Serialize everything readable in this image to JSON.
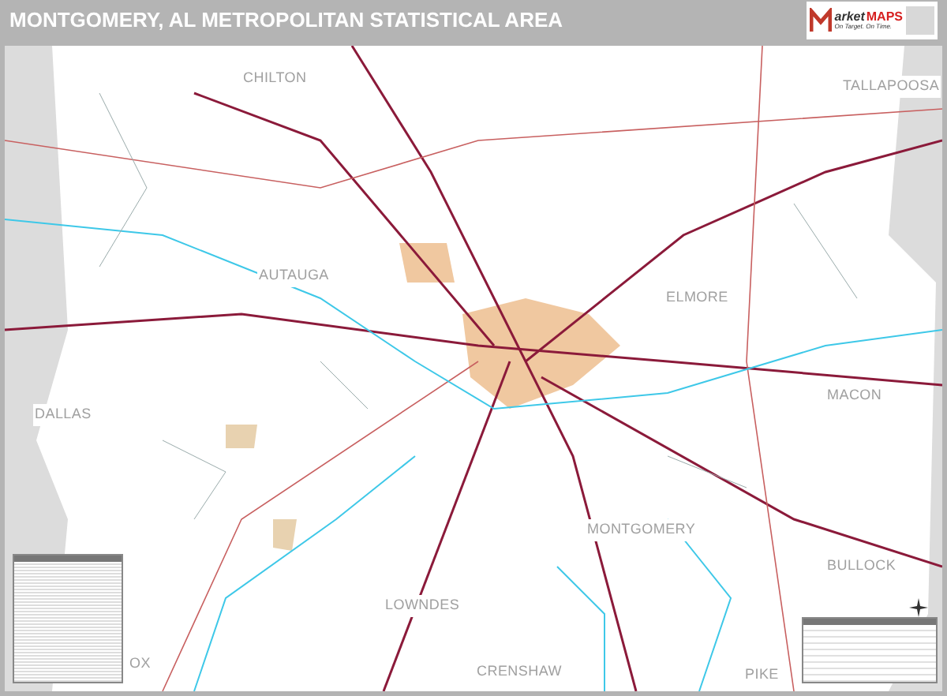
{
  "header": {
    "title": "MONTGOMERY, AL METROPOLITAN STATISTICAL AREA",
    "logo": {
      "name_part_1": "arket",
      "name_part_2": "MAPS",
      "tagline": "On Target. On Time."
    }
  },
  "map": {
    "county_labels": [
      {
        "text": "CHILTON"
      },
      {
        "text": "TALLAPOOSA"
      },
      {
        "text": "AUTAUGA"
      },
      {
        "text": "ELMORE"
      },
      {
        "text": "MACON"
      },
      {
        "text": "DALLAS"
      },
      {
        "text": "MONTGOMERY"
      },
      {
        "text": "BULLOCK"
      },
      {
        "text": "LOWNDES"
      },
      {
        "text": "CRENSHAW"
      },
      {
        "text": "PIKE"
      },
      {
        "text": "OX"
      }
    ]
  }
}
